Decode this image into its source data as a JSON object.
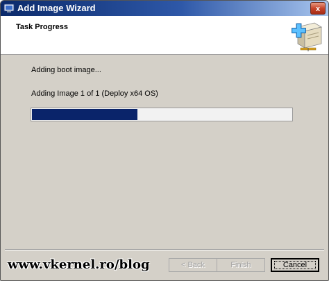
{
  "window": {
    "title": "Add Image Wizard",
    "close_label": "x"
  },
  "header": {
    "title": "Task Progress"
  },
  "main": {
    "status_text": "Adding boot image...",
    "detail_text": "Adding Image 1 of 1 (Deploy x64 OS)",
    "progress": 0.41
  },
  "footer": {
    "watermark": "www.vkernel.ro/blog",
    "back_label": "< Back",
    "finish_label": "Finish",
    "cancel_label": "Cancel"
  },
  "colors": {
    "progress_fill": "#0a246a",
    "title_bar": "#0b2a6b"
  }
}
